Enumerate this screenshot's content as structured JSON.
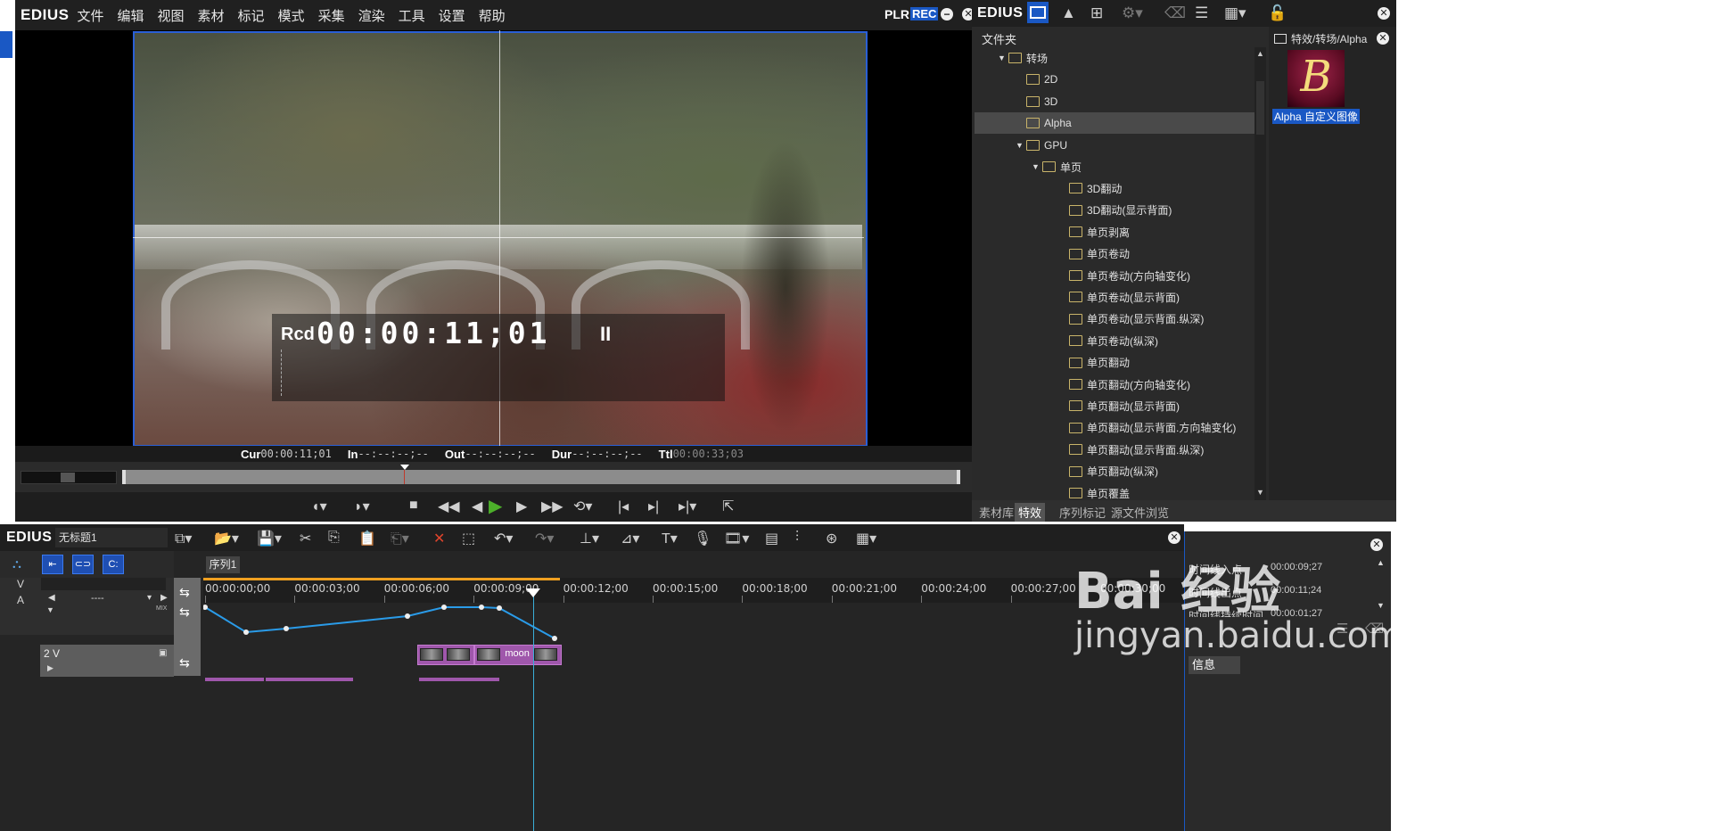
{
  "player": {
    "logo": "EDIUS",
    "menu": [
      "文件",
      "编辑",
      "视图",
      "素材",
      "标记",
      "模式",
      "采集",
      "渲染",
      "工具",
      "设置",
      "帮助"
    ],
    "plr_label": "PLR",
    "rec_label": "REC",
    "rcd_label": "Rcd",
    "rcd_timecode": "00:00:11;01",
    "pause_glyph": "II",
    "timecodes": {
      "cur_label": "Cur",
      "cur_value": "00:00:11;01",
      "in_label": "In",
      "in_value": "--:--:--;--",
      "out_label": "Out",
      "out_value": "--:--:--;--",
      "dur_label": "Dur",
      "dur_value": "--:--:--;--",
      "ttl_label": "Ttl",
      "ttl_value": "00:00:33;03"
    }
  },
  "bin": {
    "logo": "EDIUS",
    "folder_header": "文件夹",
    "right_title": "特效/转场/Alpha",
    "thumb_letter": "B",
    "thumb_caption": "Alpha 自定义图像",
    "tree": [
      {
        "label": "转场",
        "level": 1,
        "expand": "▼",
        "folder": true
      },
      {
        "label": "2D",
        "level": 2,
        "expand": "",
        "folder": true
      },
      {
        "label": "3D",
        "level": 2,
        "expand": "",
        "folder": true
      },
      {
        "label": "Alpha",
        "level": 2,
        "expand": "",
        "folder": true,
        "selected": true
      },
      {
        "label": "GPU",
        "level": 2,
        "expand": "▼",
        "folder": true
      },
      {
        "label": "单页",
        "level": 3,
        "expand": "▼",
        "folder": true
      },
      {
        "label": "3D翻动",
        "level": 4,
        "expand": "",
        "folder": false
      },
      {
        "label": "3D翻动(显示背面)",
        "level": 4,
        "expand": "",
        "folder": false
      },
      {
        "label": "单页剥离",
        "level": 4,
        "expand": "",
        "folder": false
      },
      {
        "label": "单页卷动",
        "level": 4,
        "expand": "",
        "folder": false
      },
      {
        "label": "单页卷动(方向轴变化)",
        "level": 4,
        "expand": "",
        "folder": false
      },
      {
        "label": "单页卷动(显示背面)",
        "level": 4,
        "expand": "",
        "folder": false
      },
      {
        "label": "单页卷动(显示背面.纵深)",
        "level": 4,
        "expand": "",
        "folder": false
      },
      {
        "label": "单页卷动(纵深)",
        "level": 4,
        "expand": "",
        "folder": false
      },
      {
        "label": "单页翻动",
        "level": 4,
        "expand": "",
        "folder": false
      },
      {
        "label": "单页翻动(方向轴变化)",
        "level": 4,
        "expand": "",
        "folder": false
      },
      {
        "label": "单页翻动(显示背面)",
        "level": 4,
        "expand": "",
        "folder": false
      },
      {
        "label": "单页翻动(显示背面.方向轴变化)",
        "level": 4,
        "expand": "",
        "folder": false
      },
      {
        "label": "单页翻动(显示背面.纵深)",
        "level": 4,
        "expand": "",
        "folder": false
      },
      {
        "label": "单页翻动(纵深)",
        "level": 4,
        "expand": "",
        "folder": false
      },
      {
        "label": "单页覆盖",
        "level": 4,
        "expand": "",
        "folder": false
      }
    ],
    "tabs": [
      "素材库",
      "特效",
      "序列标记",
      "源文件浏览"
    ]
  },
  "timeline": {
    "logo": "EDIUS",
    "project_name": "无标题1",
    "sequence_tab": "序列1",
    "v_label": "V",
    "a_label": "A",
    "a_value": "----",
    "mix_label": "MIX",
    "track_2v": "2 V",
    "ruler": [
      "00:00:00;00",
      "00:00:03;00",
      "00:00:06;00",
      "00:00:09;00",
      "00:00:12;00",
      "00:00:15;00",
      "00:00:18;00",
      "00:00:21;00",
      "00:00:24;00",
      "00:00:27;00",
      "00:00:30;00"
    ],
    "clip_label": "moon"
  },
  "info": {
    "rows": [
      {
        "label": "时间线入点",
        "value": "00:00:09;27"
      },
      {
        "label": "时间线出点",
        "value": "00:00:11;24"
      },
      {
        "label": "时间线持续时间",
        "value": "00:00:01;27"
      }
    ],
    "tab": "信息"
  },
  "watermark": {
    "brand": "Bai 经验",
    "url": "jingyan.baidu.com"
  },
  "colors": {
    "accent": "#1a58c4",
    "clip": "#9f57ab",
    "play": "#4caf2a",
    "keyframe_line": "#2a9be8"
  }
}
